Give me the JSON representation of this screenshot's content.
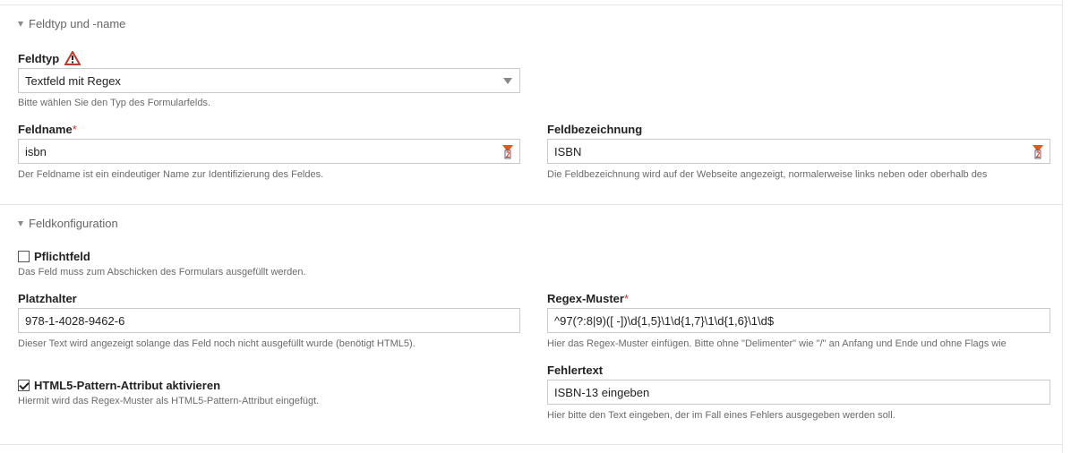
{
  "section1": {
    "title": "Feldtyp und -name",
    "field_type": {
      "label": "Feldtyp",
      "value": "Textfeld mit Regex",
      "help": "Bitte wählen Sie den Typ des Formularfelds."
    },
    "field_name": {
      "label": "Feldname",
      "required_mark": "*",
      "value": "isbn",
      "help": "Der Feldname ist ein eindeutiger Name zur Identifizierung des Feldes."
    },
    "field_caption": {
      "label": "Feldbezeichnung",
      "value": "ISBN",
      "help": "Die Feldbezeichnung wird auf der Webseite angezeigt, normalerweise links neben oder oberhalb des"
    }
  },
  "section2": {
    "title": "Feldkonfiguration",
    "required": {
      "label": "Pflichtfeld",
      "checked": false,
      "help": "Das Feld muss zum Abschicken des Formulars ausgefüllt werden."
    },
    "placeholder": {
      "label": "Platzhalter",
      "value": "978-1-4028-9462-6",
      "help": "Dieser Text wird angezeigt solange das Feld noch nicht ausgefüllt wurde (benötigt HTML5)."
    },
    "regex": {
      "label": "Regex-Muster",
      "required_mark": "*",
      "value": "^97(?:8|9)([ -])\\d{1,5}\\1\\d{1,7}\\1\\d{1,6}\\1\\d$",
      "help": "Hier das Regex-Muster einfügen. Bitte ohne \"Delimenter\" wie \"/\" an Anfang und Ende und ohne Flags wie"
    },
    "html5_pattern": {
      "label": "HTML5-Pattern-Attribut aktivieren",
      "checked": true,
      "help": "Hiermit wird das Regex-Muster als HTML5-Pattern-Attribut eingefügt."
    },
    "error_text": {
      "label": "Fehlertext",
      "value": "ISBN-13 eingeben",
      "help": "Hier bitte den Text eingeben, der im Fall eines Fehlers ausgegeben werden soll."
    }
  },
  "colors": {
    "required_mark": "#c0392b",
    "warning_icon": "#c0392b",
    "translate_icon": "#e0572a"
  },
  "icons": {
    "warning": "warning-triangle-icon",
    "translate": "translate-icon",
    "collapse": "caret-down-icon"
  }
}
